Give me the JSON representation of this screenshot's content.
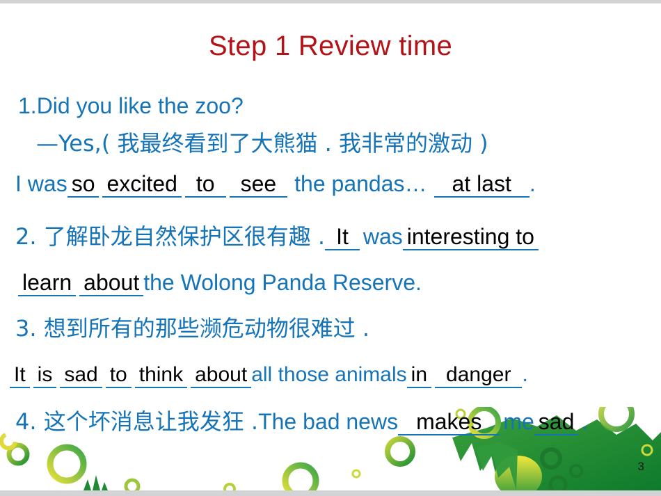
{
  "slide": {
    "title": "Step 1 Review time",
    "page_number": "3",
    "title_color": "#b31217",
    "body_color": "#1573b8",
    "answer_color": "#000000"
  },
  "lines": {
    "q1_prompt": "1.Did you like the zoo?",
    "q1_chinese": "—Yes,( 我最终看到了大熊猫 . 我非常的激动 )",
    "q1_ans": {
      "pre": "I was",
      "a1": "so",
      "a2": "excited",
      "a3": "to",
      "a4": "see",
      "mid": "the pandas…",
      "a5": "at last",
      "end": "."
    },
    "q2_chinese": "2. 了解卧龙自然保护区很有趣 .",
    "q2_ans": {
      "a1": "It",
      "mid": "was",
      "a2": "interesting to",
      "a3": "learn",
      "a4": "about",
      "end": "the Wolong Panda Reserve."
    },
    "q3_chinese": "3. 想到所有的那些濒危动物很难过 .",
    "q3_ans": {
      "a1": "It",
      "a2": "is",
      "a3": "sad",
      "a4": "to",
      "a5": "think",
      "a6": "about",
      "mid": "all those animals",
      "a7": "in",
      "a8": "danger",
      "end": "."
    },
    "q4_chinese": "4. 这个坏消息让我发狂 .",
    "q4_ans": {
      "pre": "The bad news",
      "a1": "makes",
      "mid": "me",
      "a2": "sad",
      "end": "."
    }
  }
}
